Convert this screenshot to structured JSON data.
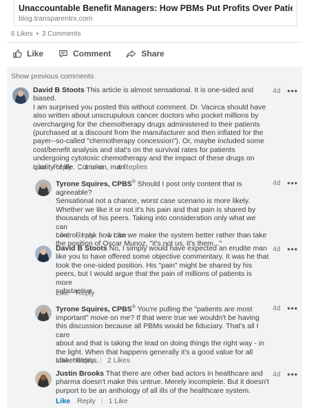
{
  "post": {
    "link_title": "Unaccountable Benefit Managers: How PBMs Put Profits Over Patients",
    "link_domain": "blog.transparentrx.com",
    "likes": "6 Likes",
    "dot": "•",
    "comments_count": "3 Comments"
  },
  "actions": {
    "like": "Like",
    "comment": "Comment",
    "share": "Share"
  },
  "show_previous": "Show previous comments",
  "comments": [
    {
      "author": "David B Stoots",
      "lines": [
        "This article is almost sensational.  It is one-sided and biased.",
        "I am surprised you posted this without comment.  Dr. Vacirca should have",
        "also written about unscrupulous cancer doctors who pocket millions by",
        "overcharging for the chemotherapy drugs administered to their patients",
        "(purchased at a discount from the manufacturer and then inflated for the",
        "payer--so-called \"chemotherapy concession\").  Or, maybe included some",
        "cost/benefit analysis and stat's on the survival  rates for patients",
        "undergoing cytotoxic chemotherapy and the impact of these drugs on",
        "quality of life. Come on, man."
      ],
      "time": "4d",
      "like": "Like",
      "reply": "Reply",
      "likes_count": "1 Like",
      "replies_count": "4 Replies"
    },
    {
      "author": "Tyrone Squires, CPBS",
      "badge": "®",
      "lines": [
        "Should I post only content that is agreeable?",
        "Sensational not a chance, worst case scenario is more likely.",
        "Whether we like it or not it's his pain and that pain is shared by",
        "thousands of his peers. Taking into consideration only what we can",
        "control, I ask how can we make the system better rather than take",
        "the position of Oscar Munoz, \"it's not us, it's them...\""
      ],
      "time": "4d",
      "like": "Like",
      "reply": "Reply",
      "likes_count": "1 Like"
    },
    {
      "author": "David B Stoots",
      "lines": [
        "No, I simply would have expected an erudite man",
        "like you to have offered some objective commentary.  It was he that",
        "took the one-sided position.  His \"pain\" might be shared by his",
        "peers, but I would argue that the pain of millions of patients is more",
        "substantive."
      ],
      "time": "4d",
      "like": "Like",
      "reply": "Reply"
    },
    {
      "author": "Tyrone Squires, CPBS",
      "badge": "®",
      "lines": [
        "You're pulling the \"patients are most",
        "important\" move on me? If that were true we wouldn't be having",
        "this discussion because all PBMs would be fiduciary.  That's all I care",
        "about and that is taking the lead on doing things the right way - in",
        "the light. When that happens generally it's a good value for all",
        "stakeholders."
      ],
      "time": "4d",
      "like": "Like",
      "reply": "Reply",
      "likes_count": "2 Likes"
    },
    {
      "author": "Justin Brooks",
      "lines": [
        "That there are other bad actors in healthcare and",
        "pharma doesn't make this untrue. Merely incomplete. But it doesn't",
        "purport to be an anthology of all ills of the healthcare system."
      ],
      "time": "4d",
      "like": "Like",
      "reply": "Reply",
      "likes_count": "1 Like"
    }
  ],
  "colors": {
    "accent": "#0073b1",
    "comment_bg": "#f2f3f5"
  }
}
